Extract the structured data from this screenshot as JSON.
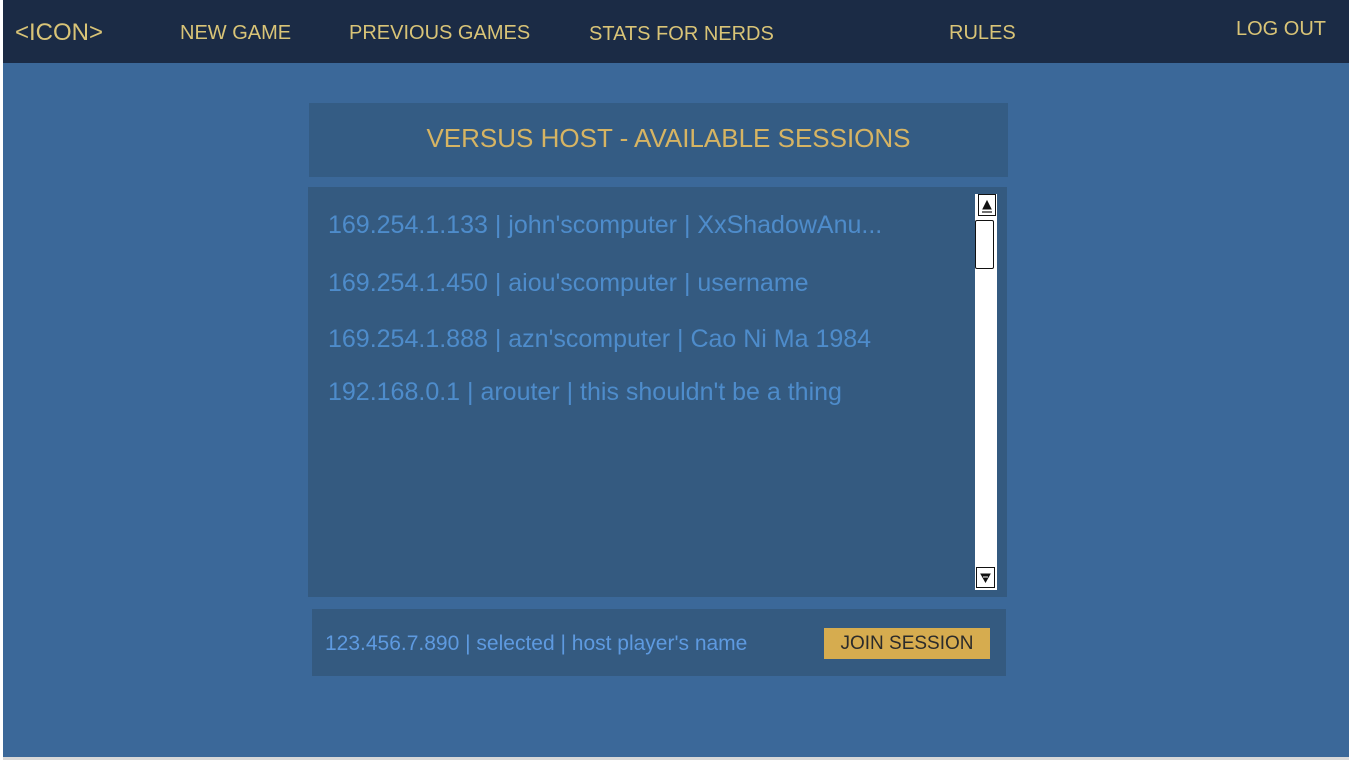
{
  "nav": {
    "icon_label": "<ICON>",
    "new_game": "NEW GAME",
    "previous_games": "PREVIOUS GAMES",
    "stats_for_nerds": "STATS FOR NERDS",
    "rules": "RULES",
    "log_out": "LOG OUT"
  },
  "page": {
    "title": "VERSUS HOST - AVAILABLE SESSIONS"
  },
  "sessions": [
    {
      "label": "169.254.1.133 | john'scomputer | XxShadowAnu..."
    },
    {
      "label": "169.254.1.450 | aiou'scomputer | username"
    },
    {
      "label": "169.254.1.888 | azn'scomputer | Cao Ni Ma 1984"
    },
    {
      "label": "192.168.0.1 | arouter | this shouldn't be a thing"
    }
  ],
  "footer": {
    "selected_text": "123.456.7.890 | selected | host player's name",
    "join_label": "JOIN SESSION"
  },
  "colors": {
    "background": "#3b6899",
    "navbar": "#1b2b45",
    "accent_gold": "#d6b463",
    "list_text": "#4e8ccb",
    "button": "#d6ac4f"
  },
  "icons": {
    "scroll_up": "scroll-up-arrow-icon",
    "scroll_down": "scroll-down-arrow-icon"
  }
}
